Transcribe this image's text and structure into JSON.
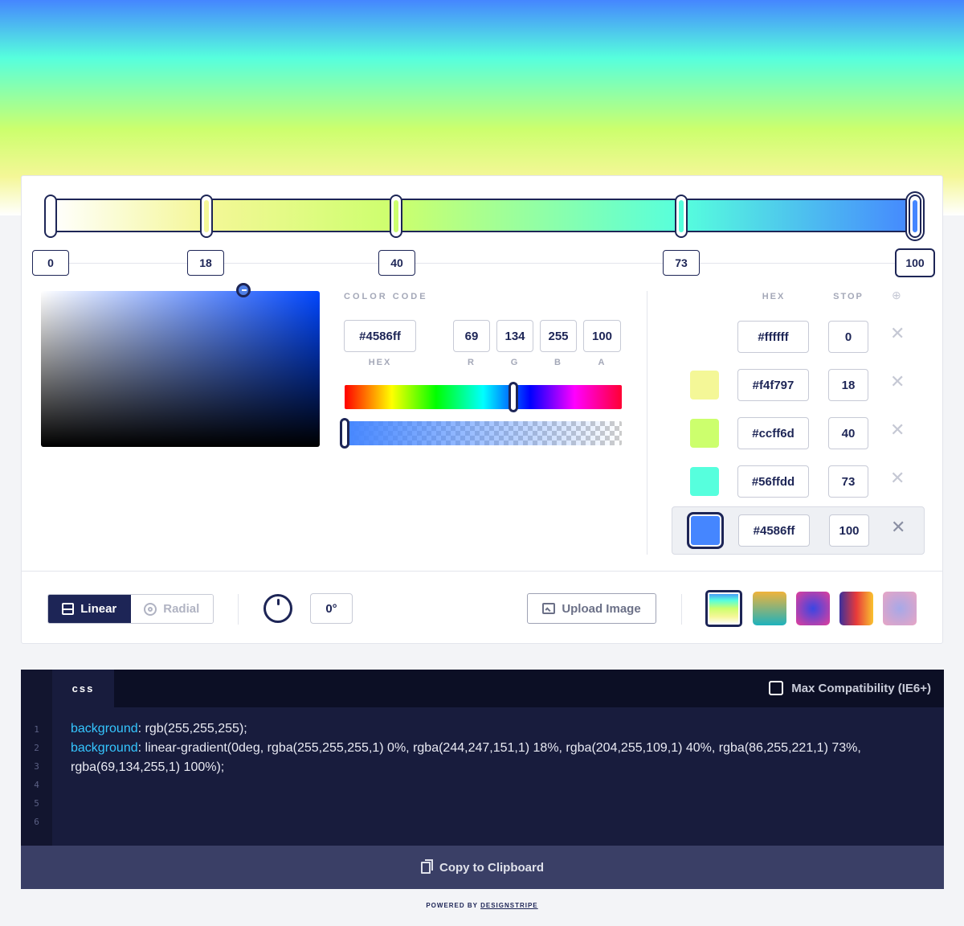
{
  "gradient": {
    "stops": [
      {
        "hex": "#ffffff",
        "stop": "0"
      },
      {
        "hex": "#f4f797",
        "stop": "18"
      },
      {
        "hex": "#ccff6d",
        "stop": "40"
      },
      {
        "hex": "#56ffdd",
        "stop": "73"
      },
      {
        "hex": "#4586ff",
        "stop": "100"
      }
    ],
    "active_index": 4
  },
  "picker": {
    "section_label": "COLOR CODE",
    "hex": "#4586ff",
    "r": "69",
    "g": "134",
    "b": "255",
    "a": "100",
    "hex_label": "HEX",
    "r_label": "R",
    "g_label": "G",
    "b_label": "B",
    "a_label": "A",
    "hue_level": 0.61,
    "alpha_level": 1.0
  },
  "stops_table": {
    "hex_header": "HEX",
    "stop_header": "STOP",
    "add_icon": "plus-circle-icon",
    "remove_icon": "close-icon"
  },
  "controls": {
    "linear_label": "Linear",
    "radial_label": "Radial",
    "angle": "0°",
    "upload_label": "Upload Image",
    "presets": [
      {
        "colors": [
          "#ffffff",
          "#f4f797",
          "#ccff6d",
          "#56ffdd",
          "#4586ff"
        ],
        "active": true
      },
      {
        "colors": [
          "#f0b33b",
          "#1eb2bd"
        ],
        "active": false
      },
      {
        "colors": [
          "#e23f9a",
          "#3a46e3"
        ],
        "active": false
      },
      {
        "colors": [
          "#3a2f9c",
          "#e83a3a",
          "#f9c22e"
        ],
        "active": false
      },
      {
        "colors": [
          "#e9a5c4",
          "#a6a8e8"
        ],
        "active": false
      }
    ]
  },
  "code": {
    "tab_label": "css",
    "compat_label": "Max Compatibility (IE6+)",
    "line_numbers": [
      "1",
      "2",
      "3",
      "4",
      "5",
      "6"
    ],
    "line1_prop": "background",
    "line1_value": ": rgb(255,255,255);",
    "line2_prop": "background",
    "line2_value": ": linear-gradient(0deg, rgba(255,255,255,1) 0%, rgba(244,247,151,1) 18%, rgba(204,255,109,1) 40%, rgba(86,255,221,1) 73%, rgba(69,134,255,1) 100%);",
    "copy_label": "Copy to Clipboard"
  },
  "footer": {
    "prefix": "POWERED BY ",
    "brand": "DESIGNSTRIPE"
  }
}
